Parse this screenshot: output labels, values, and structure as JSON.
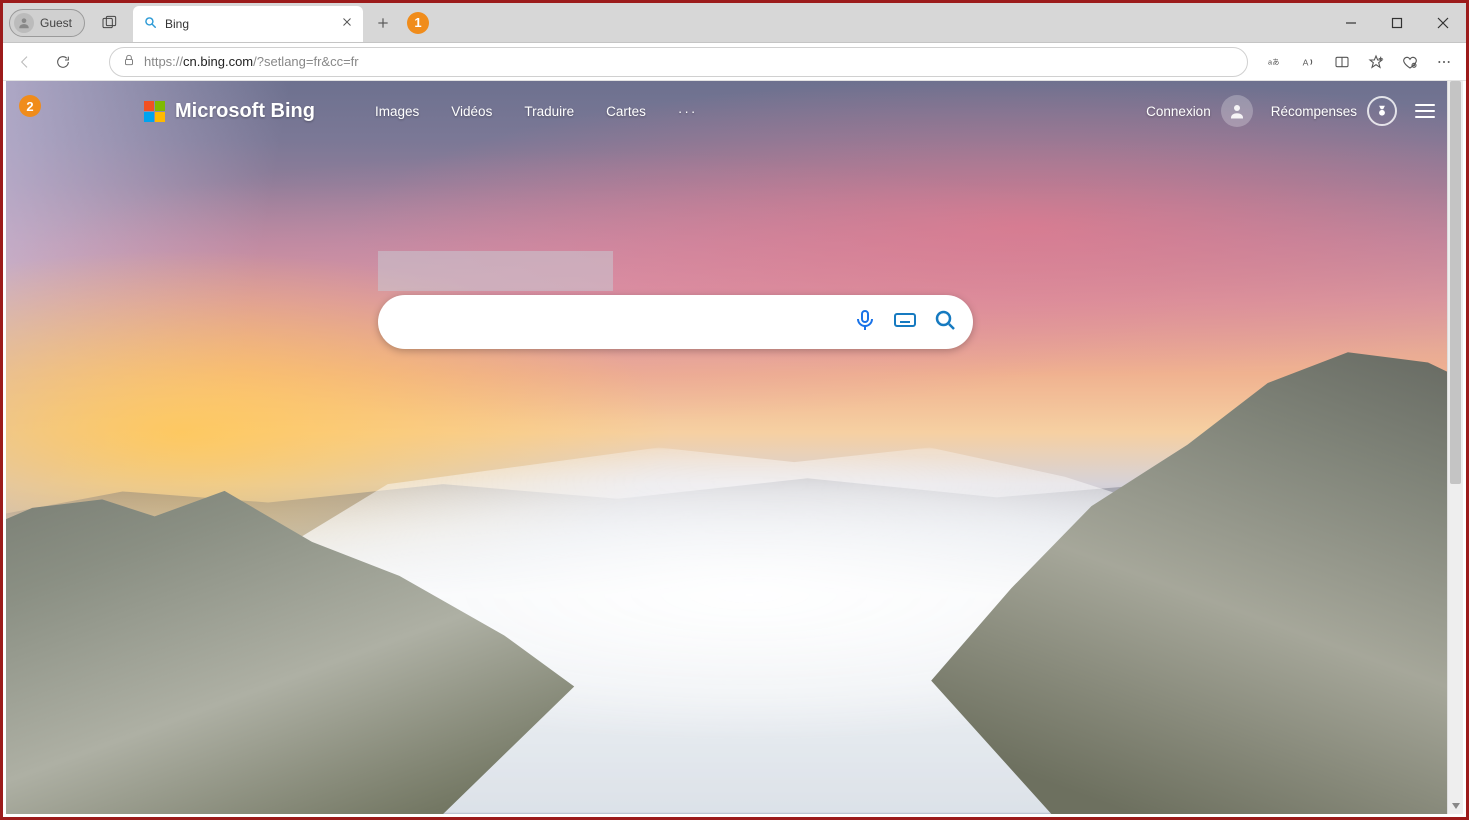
{
  "browser": {
    "guest_label": "Guest",
    "tab_title": "Bing",
    "url": "https://cn.bing.com/?setlang=fr&cc=fr",
    "url_host": "cn.bing.com",
    "url_path": "/?setlang=fr&cc=fr",
    "url_scheme": "https://"
  },
  "callouts": {
    "one": "1",
    "two": "2"
  },
  "bing": {
    "logo_text": "Microsoft Bing",
    "nav": {
      "images": "Images",
      "videos": "Vidéos",
      "translate": "Traduire",
      "maps": "Cartes",
      "more": "···"
    },
    "signin": "Connexion",
    "rewards": "Récompenses",
    "search_placeholder": ""
  }
}
